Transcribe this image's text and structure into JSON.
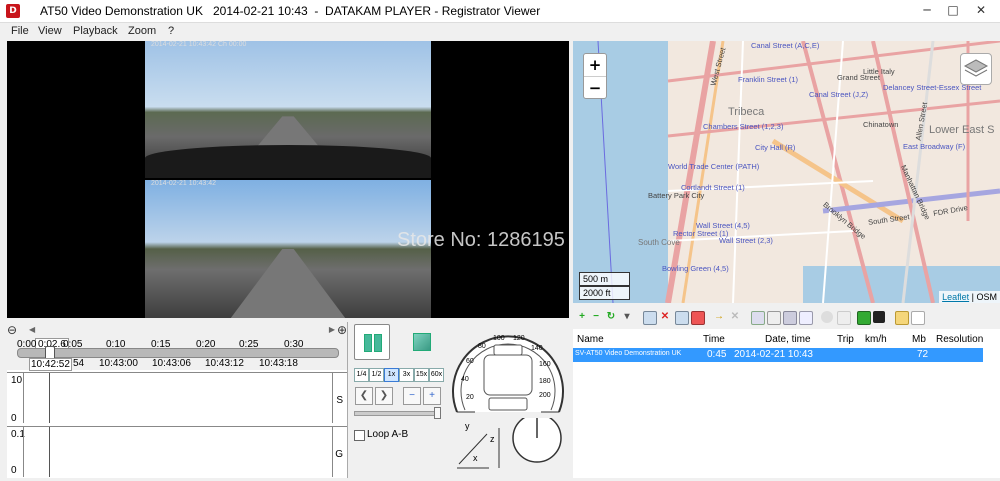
{
  "window": {
    "title": "AT50 Video Demonstration UK   2014-02-21 10:43  -  DATAKAM PLAYER - Registrator Viewer",
    "app_icon_glyph": "D",
    "minimize_icon": "minimize-icon",
    "maximize_icon": "maximize-icon",
    "close_icon": "close-icon"
  },
  "menu": [
    "File",
    "View",
    "Playback",
    "Zoom",
    "?"
  ],
  "video": {
    "osd_top": "2014-02-21 10:43:42  Ch 00:00",
    "osd_bottom": "2014-02-21 10:43:42",
    "watermark": "Store No: 1286195"
  },
  "map": {
    "zoom_in": "+",
    "zoom_out": "−",
    "scale_metric": "500 m",
    "scale_imperial": "2000 ft",
    "attribution_link": "Leaflet",
    "attribution_sep": " | ",
    "attribution_osm": "OSM",
    "labels": [
      {
        "text": "Canal Street (A,C,E)",
        "cls": "station"
      },
      {
        "text": "Little Italy",
        "cls": ""
      },
      {
        "text": "Franklin Street (1)",
        "cls": "station"
      },
      {
        "text": "Grand Street",
        "cls": ""
      },
      {
        "text": "Delancey Street-Essex Street",
        "cls": "station"
      },
      {
        "text": "Canal Street (J,Z)",
        "cls": "station"
      },
      {
        "text": "Lower East S",
        "cls": "area"
      },
      {
        "text": "Tribeca",
        "cls": "area"
      },
      {
        "text": "Chambers Street (1,2,3)",
        "cls": "station"
      },
      {
        "text": "Chinatown",
        "cls": ""
      },
      {
        "text": "City Hall (R)",
        "cls": "station"
      },
      {
        "text": "East Broadway (F)",
        "cls": "station"
      },
      {
        "text": "World Trade Center (PATH)",
        "cls": "station"
      },
      {
        "text": "Battery Park City",
        "cls": ""
      },
      {
        "text": "Cortlandt Street (1)",
        "cls": "station"
      },
      {
        "text": "Wall Street (4,5)",
        "cls": "station"
      },
      {
        "text": "Rector Street (1)",
        "cls": "station"
      },
      {
        "text": "Wall Street (2,3)",
        "cls": "station"
      },
      {
        "text": "Bowling Green (4,5)",
        "cls": "station"
      },
      {
        "text": "West Street",
        "cls": ""
      },
      {
        "text": "Allen Street",
        "cls": ""
      },
      {
        "text": "FDR Drive",
        "cls": ""
      },
      {
        "text": "Brooklyn Bridge",
        "cls": ""
      },
      {
        "text": "South Street",
        "cls": ""
      },
      {
        "text": "Manhattan Bridge",
        "cls": ""
      },
      {
        "text": "South Cove",
        "cls": "area"
      }
    ]
  },
  "timeline": {
    "zoom_out_icon": "zoom-out-icon",
    "zoom_in_icon": "zoom-in-icon",
    "position_label": "0:02.6",
    "ticks": [
      "0:00",
      "0:05",
      "0:10",
      "0:15",
      "0:20",
      "0:25",
      "0:30"
    ],
    "current_time": "10:42:52",
    "current_time_suffix": "54",
    "times": [
      "10:43:00",
      "10:43:06",
      "10:43:12",
      "10:43:18"
    ],
    "graphs": [
      {
        "ymax": "10",
        "ymin": "0",
        "channel": "S"
      },
      {
        "ymax": "0.1",
        "ymin": "0",
        "channel": "G"
      }
    ]
  },
  "controls": {
    "pause_icon": "pause-icon",
    "stop_icon": "stop-icon",
    "speeds": [
      "1/4",
      "1/2",
      "1x",
      "3x",
      "15x",
      "60x"
    ],
    "active_speed": "1x",
    "loop_label": "Loop A-B"
  },
  "gauge": {
    "ticks": [
      "20",
      "40",
      "60",
      "80",
      "100",
      "120",
      "140",
      "160",
      "180",
      "200"
    ],
    "axis_x": "x",
    "axis_y": "y",
    "axis_z": "z"
  },
  "filelist": {
    "columns": [
      "Name",
      "Time",
      "Date, time",
      "Trip",
      "km/h",
      "Mb",
      "Resolution"
    ],
    "rows": [
      {
        "name": "SV-AT50 Video Demonstration UK",
        "time": "0:45",
        "datetime": "2014-02-21 10:43",
        "trip": "",
        "kmh": "",
        "mb": "72",
        "resolution": ""
      }
    ],
    "colors": {
      "selection": "#3399ff"
    }
  }
}
